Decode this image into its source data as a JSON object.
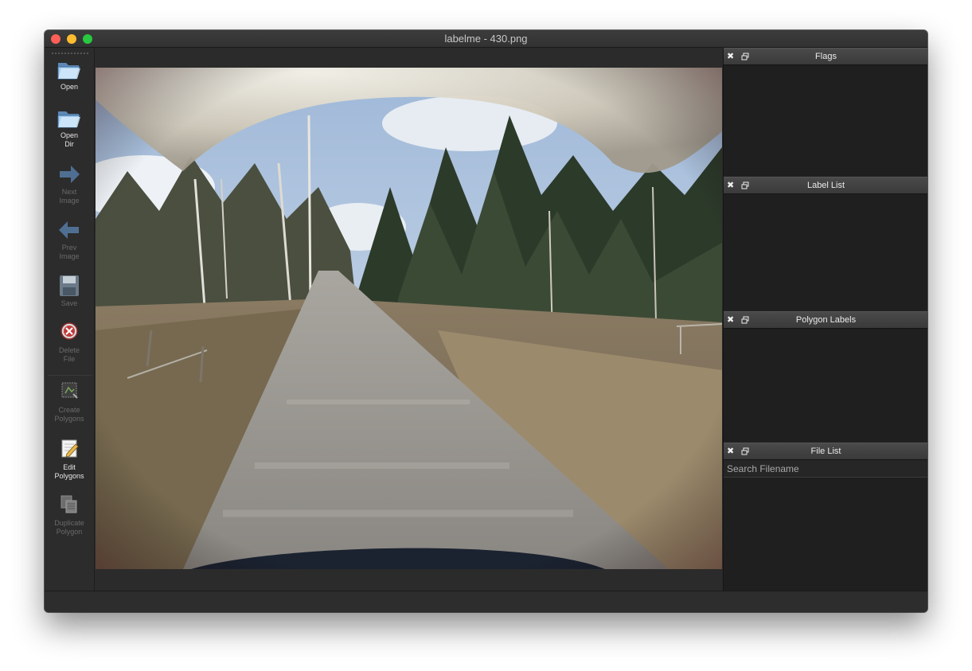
{
  "window": {
    "title": "labelme - 430.png"
  },
  "toolbar": {
    "items": [
      {
        "label": "Open",
        "icon": "folder-open-icon",
        "enabled": true
      },
      {
        "label": "Open\nDir",
        "icon": "folder-open-icon",
        "enabled": true
      },
      {
        "label": "Next\nImage",
        "icon": "arrow-right-icon",
        "enabled": false
      },
      {
        "label": "Prev\nImage",
        "icon": "arrow-left-icon",
        "enabled": false
      },
      {
        "label": "Save",
        "icon": "save-icon",
        "enabled": false
      },
      {
        "label": "Delete\nFile",
        "icon": "delete-icon",
        "enabled": false
      },
      {
        "label": "Create\nPolygons",
        "icon": "polygon-icon",
        "enabled": false
      },
      {
        "label": "Edit\nPolygons",
        "icon": "edit-icon",
        "enabled": true
      },
      {
        "label": "Duplicate\nPolygon",
        "icon": "duplicate-icon",
        "enabled": false
      }
    ],
    "expand_icon": "double-chevron-down-icon"
  },
  "canvas": {
    "image_description": "road-photo"
  },
  "dock": {
    "flags": {
      "title": "Flags"
    },
    "label_list": {
      "title": "Label List"
    },
    "polygon_labels": {
      "title": "Polygon Labels"
    },
    "file_list": {
      "title": "File List",
      "search_placeholder": "Search Filename"
    }
  },
  "colors": {
    "accent_close": "#fe5f57",
    "accent_min": "#febc2e",
    "accent_max": "#28c840"
  }
}
